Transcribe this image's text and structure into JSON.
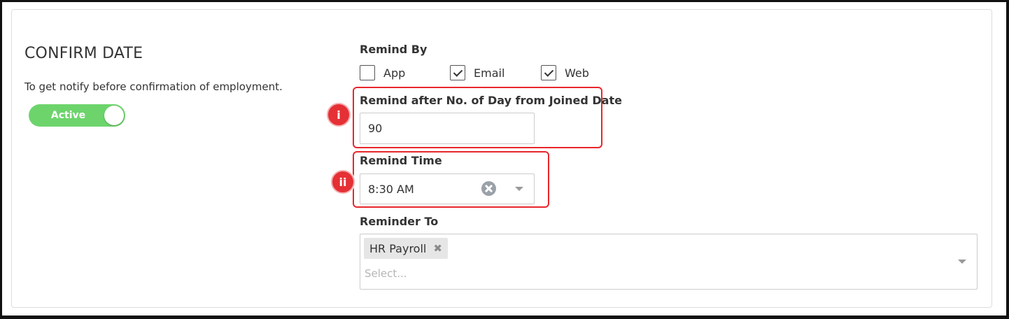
{
  "section": {
    "title": "CONFIRM DATE",
    "description": "To get notify before confirmation of employment."
  },
  "status_toggle": {
    "label": "Active",
    "on": true,
    "color": "#6dd46c"
  },
  "remind_by": {
    "label": "Remind By",
    "options": [
      {
        "label": "App",
        "checked": false
      },
      {
        "label": "Email",
        "checked": true
      },
      {
        "label": "Web",
        "checked": true
      }
    ]
  },
  "remind_after": {
    "label": "Remind after No. of Day from Joined Date",
    "value": "90"
  },
  "remind_time": {
    "label": "Remind Time",
    "value": "8:30 AM"
  },
  "reminder_to": {
    "label": "Reminder To",
    "tags": [
      {
        "label": "HR Payroll",
        "remove_icon": "✖"
      }
    ],
    "placeholder": "Select..."
  },
  "markers": {
    "first": "i",
    "second": "ii"
  },
  "colors": {
    "highlight": "#e8262c",
    "marker": "#e53035"
  },
  "icons": {
    "clear": "clear-circle-icon",
    "dropdown": "chevron-down-icon",
    "check": "checkmark-icon"
  }
}
